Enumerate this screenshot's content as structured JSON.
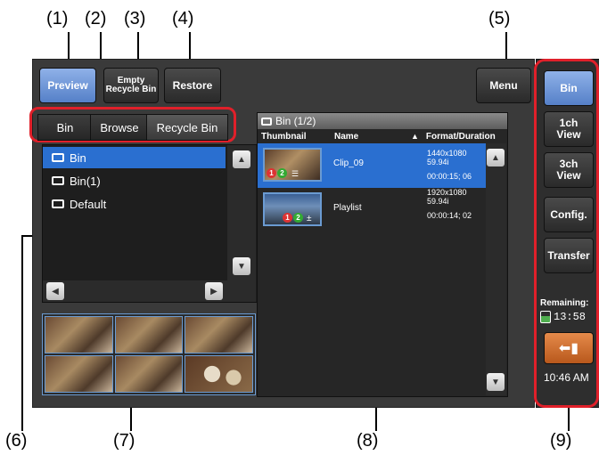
{
  "callouts": [
    "(1)",
    "(2)",
    "(3)",
    "(4)",
    "(5)",
    "(6)",
    "(7)",
    "(8)",
    "(9)"
  ],
  "toolbar": {
    "preview": "Preview",
    "empty_recycle_line1": "Empty",
    "empty_recycle_line2": "Recycle Bin",
    "restore": "Restore",
    "menu": "Menu"
  },
  "tabs": [
    "Bin",
    "Browse",
    "Recycle Bin"
  ],
  "tree": {
    "items": [
      {
        "label": "Bin",
        "selected": true
      },
      {
        "label": "Bin(1)",
        "selected": false
      },
      {
        "label": "Default",
        "selected": false
      }
    ]
  },
  "bin_panel": {
    "title": "Bin (1/2)",
    "columns": [
      "Thumbnail",
      "Name",
      "Format/Duration"
    ],
    "rows": [
      {
        "name": "Clip_09",
        "format": "1440x1080 59.94i",
        "duration": "00:00:15; 06",
        "selected": true
      },
      {
        "name": "Playlist",
        "format": "1920x1080 59.94i",
        "duration": "00:00:14; 02",
        "selected": false
      }
    ]
  },
  "sidebar": {
    "bin": "Bin",
    "view1_line1": "1ch",
    "view1_line2": "View",
    "view3_line1": "3ch",
    "view3_line2": "View",
    "config": "Config.",
    "transfer": "Transfer",
    "remaining_label": "Remaining:",
    "remaining_time": "13:58",
    "clock": "10:46 AM"
  },
  "colors": {
    "accent": "#2a6fd0",
    "callout_border": "#e0202a",
    "active_button": "#6b93d8",
    "exit_button": "#d06a2a"
  }
}
